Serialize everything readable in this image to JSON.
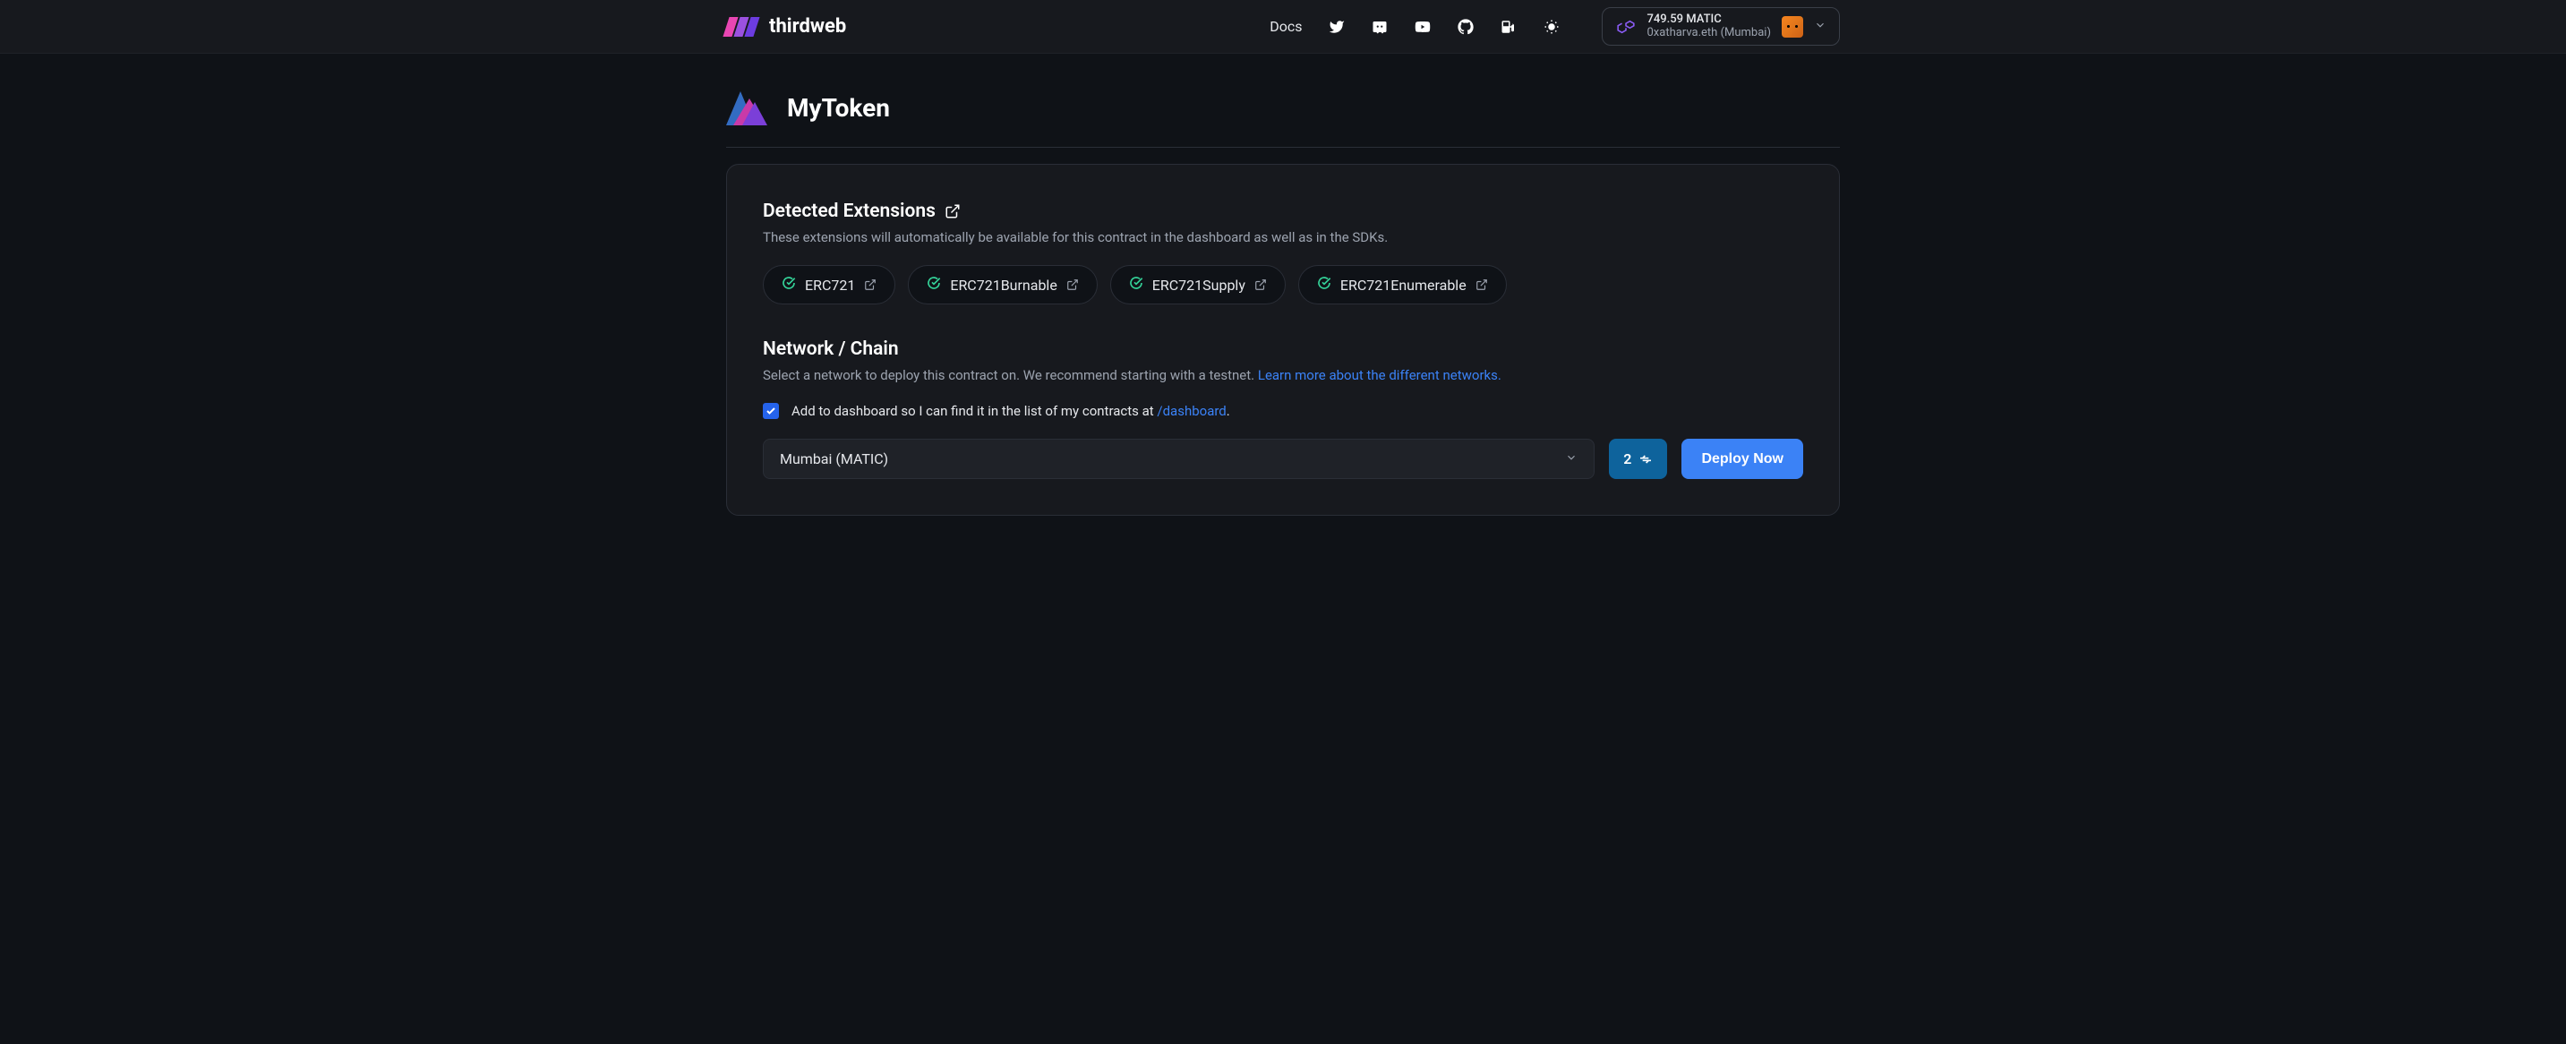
{
  "brand": "thirdweb",
  "nav": {
    "docs": "Docs"
  },
  "wallet": {
    "balance": "749.59 MATIC",
    "address": "0xatharva.eth (Mumbai)"
  },
  "page": {
    "title": "MyToken"
  },
  "extensions": {
    "title": "Detected Extensions",
    "subtitle": "These extensions will automatically be available for this contract in the dashboard as well as in the SDKs.",
    "items": [
      "ERC721",
      "ERC721Burnable",
      "ERC721Supply",
      "ERC721Enumerable"
    ]
  },
  "network": {
    "title": "Network / Chain",
    "subtitle_prefix": "Select a network to deploy this contract on. We recommend starting with a testnet. ",
    "learn_more": "Learn more about the different networks.",
    "checkbox_prefix": "Add to dashboard so I can find it in the list of my contracts at ",
    "dashboard_link": "/dashboard",
    "checkbox_suffix": ".",
    "selected": "Mumbai (MATIC)"
  },
  "deploy": {
    "tx_count": "2",
    "button": "Deploy Now"
  }
}
